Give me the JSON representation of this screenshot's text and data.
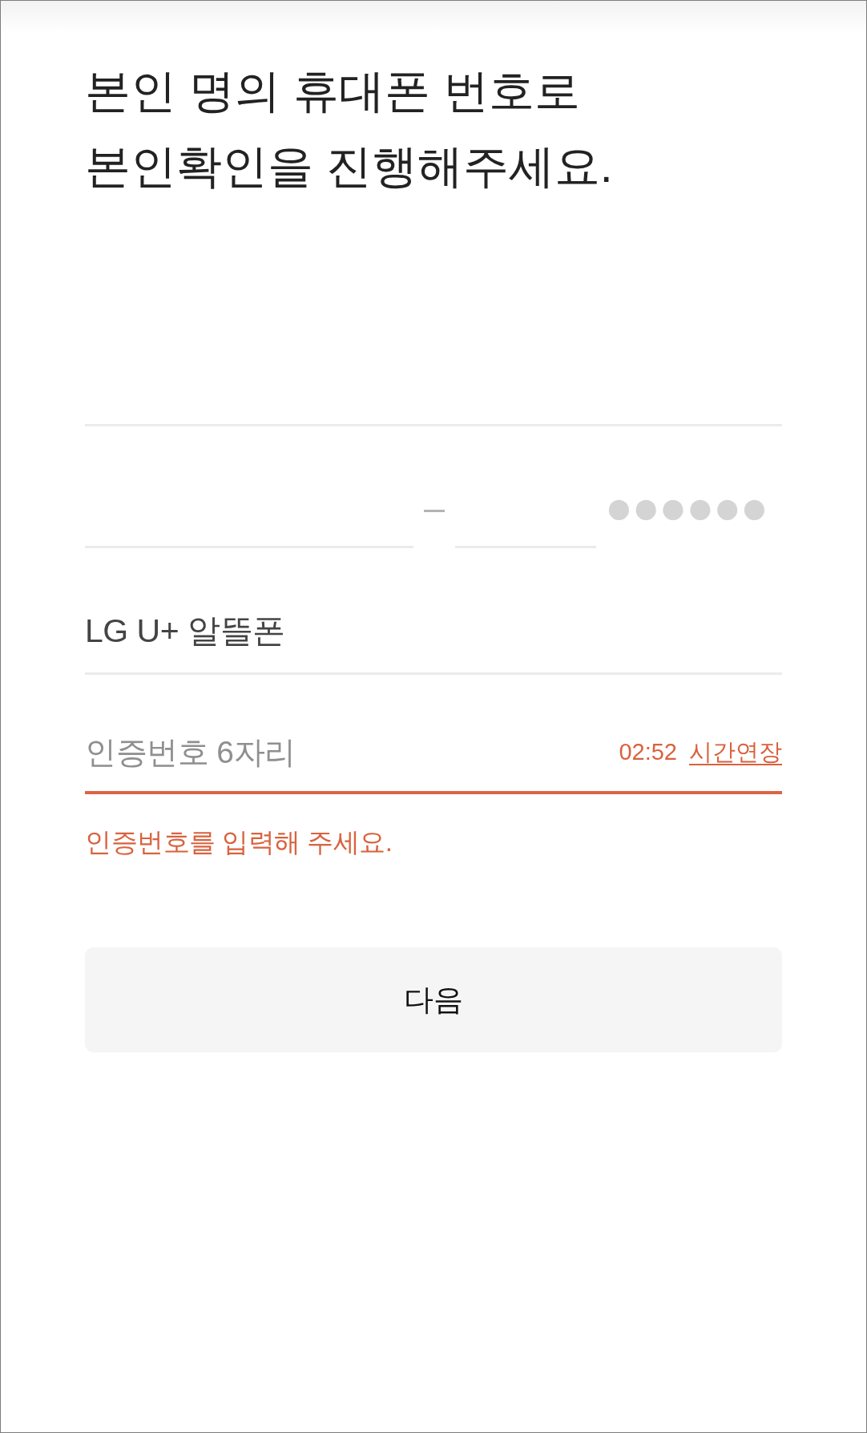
{
  "heading": {
    "lines": [
      "본인 명의 휴대폰 번호로",
      "본인확인을 진행해주세요."
    ]
  },
  "identity_row": {
    "parts": [
      {
        "kind": "field"
      },
      {
        "kind": "separator"
      },
      {
        "kind": "field"
      },
      {
        "kind": "masked",
        "text": "●●●●●●"
      }
    ]
  },
  "carrier": {
    "value": "LG U+ 알뜰폰"
  },
  "auth_code": {
    "placeholder": "인증번호 6자리",
    "timer": "02:52",
    "extend_link": "시간연장",
    "invalid": true,
    "error": "인증번호를 입력해 주세요."
  },
  "next_button": {
    "label": "다음",
    "disabled": true
  }
}
